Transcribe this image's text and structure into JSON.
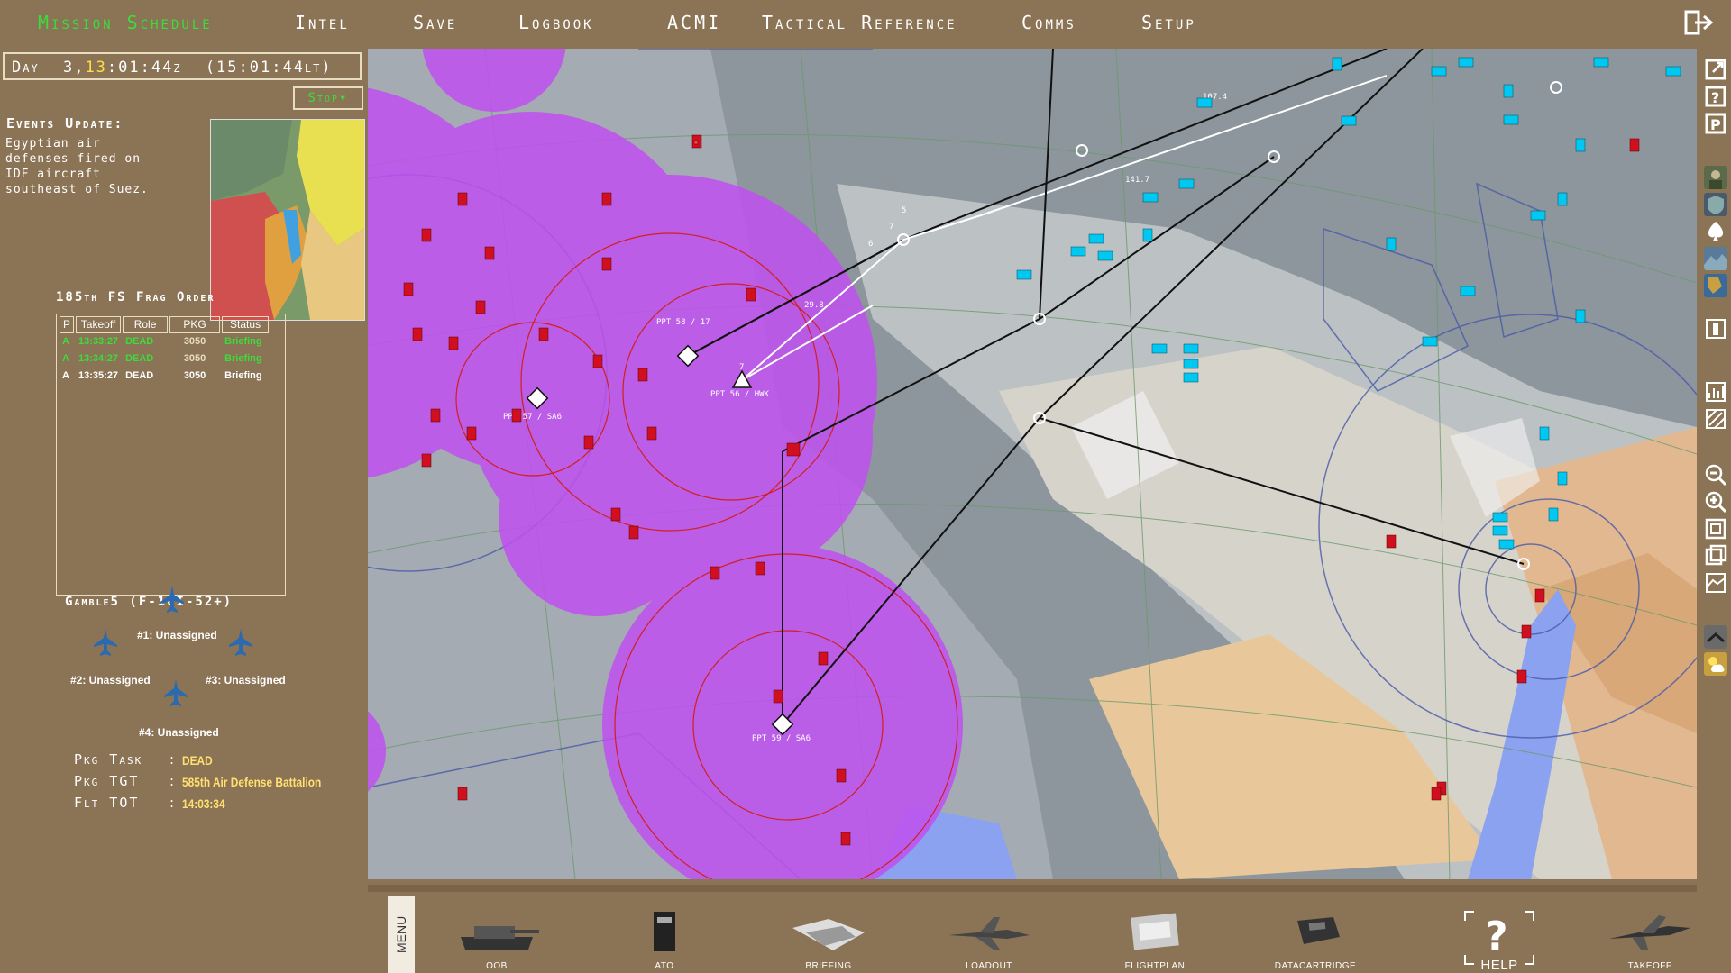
{
  "menu": {
    "items": [
      "Mission Schedule",
      "Intel",
      "Save",
      "Logbook",
      "ACMI",
      "Tactical Reference",
      "Comms",
      "Setup"
    ],
    "active_index": 0
  },
  "clock": {
    "day_label": "Day",
    "day": "3",
    "hour": "13",
    "rest": ":01:44z",
    "local": "(15:01:44lt)"
  },
  "stop_button": "Stop▾",
  "events": {
    "title": "Events Update:",
    "text": "Egyptian air defenses fired on IDF aircraft southeast of Suez."
  },
  "frag": {
    "title": "185th FS Frag Order",
    "columns": [
      "P",
      "Takeoff",
      "Role",
      "PKG",
      "Status"
    ],
    "rows": [
      {
        "p": "A",
        "takeoff": "13:33:27",
        "role": "DEAD",
        "pkg": "3050",
        "status": "Briefing",
        "style": "green"
      },
      {
        "p": "A",
        "takeoff": "13:34:27",
        "role": "DEAD",
        "pkg": "3050",
        "status": "Briefing",
        "style": "green"
      },
      {
        "p": "A",
        "takeoff": "13:35:27",
        "role": "DEAD",
        "pkg": "3050",
        "status": "Briefing",
        "style": "white"
      }
    ]
  },
  "flight": {
    "name": "Gamble5 (F-16I-52+)",
    "slots": [
      "#1: Unassigned",
      "#2: Unassigned",
      "#3: Unassigned",
      "#4: Unassigned"
    ]
  },
  "package": {
    "task_label": "Pkg Task",
    "task": "DEAD",
    "tgt_label": "Pkg TGT",
    "tgt": "585th Air Defense Battalion",
    "tot_label": "Flt TOT",
    "tot": "14:03:34"
  },
  "map_labels": {
    "ppt58": "PPT 58 / 17",
    "ppt57": "PPT 57 / SA6",
    "ppt56": "PPT 56 / HWK",
    "ppt59": "PPT 59 / SA6",
    "wp107": "107.4",
    "wp141": "141.7",
    "wp29": "29.8",
    "wp5": "5",
    "wp6": "6",
    "wp7": "7",
    "wp7b": "7"
  },
  "bottom": {
    "menu_tab": "MENU",
    "items": [
      "OOB",
      "ATO",
      "BRIEFING",
      "LOADOUT",
      "FLIGHTPLAN",
      "DATACARTRIDGE",
      "HELP",
      "TAKEOFF"
    ]
  },
  "colors": {
    "accent_green": "#3cdc3c",
    "yellow": "#ffe040",
    "panel_bg": "#8b7355",
    "sam_magenta": "#c050f0",
    "friendly_cyan": "#00c8f0",
    "enemy_red": "#d01020"
  }
}
